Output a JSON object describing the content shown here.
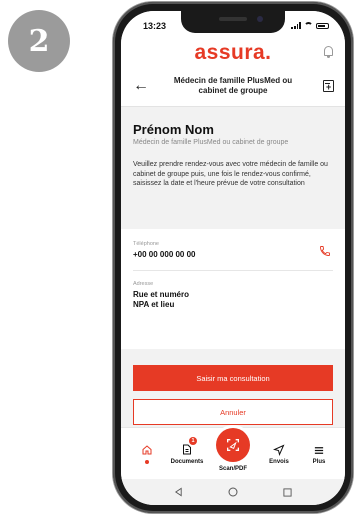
{
  "step_number": "2",
  "status_bar": {
    "time": "13:23"
  },
  "brand": {
    "logo_text": "assura."
  },
  "header": {
    "title": "Médecin de famille PlusMed ou cabinet de groupe"
  },
  "provider": {
    "name": "Prénom Nom",
    "subtitle": "Médecin de famille PlusMed ou cabinet de groupe",
    "instructions": "Veuillez prendre rendez-vous avec votre médecin de famille ou cabinet de groupe puis, une fois le rendez-vous confirmé, saisissez la date et l'heure prévue de votre consultation"
  },
  "contact": {
    "phone_label": "Téléphone",
    "phone_value": "+00 00 000 00 00",
    "address_label": "Adresse",
    "address_line1": "Rue et numéro",
    "address_line2": "NPA et lieu"
  },
  "actions": {
    "primary_label": "Saisir ma consultation",
    "secondary_label": "Annuler"
  },
  "tab_bar": {
    "documents_label": "Documents",
    "documents_badge": "1",
    "scan_label": "Scan/PDF",
    "envois_label": "Envois",
    "plus_label": "Plus"
  },
  "colors": {
    "accent": "#e63a25",
    "badge_grey": "#9b9b9b"
  },
  "icons": [
    "home-icon",
    "document-icon",
    "scan-icon",
    "send-icon",
    "menu-icon",
    "phone-icon",
    "bell-icon",
    "back-arrow-icon",
    "add-document-icon"
  ]
}
